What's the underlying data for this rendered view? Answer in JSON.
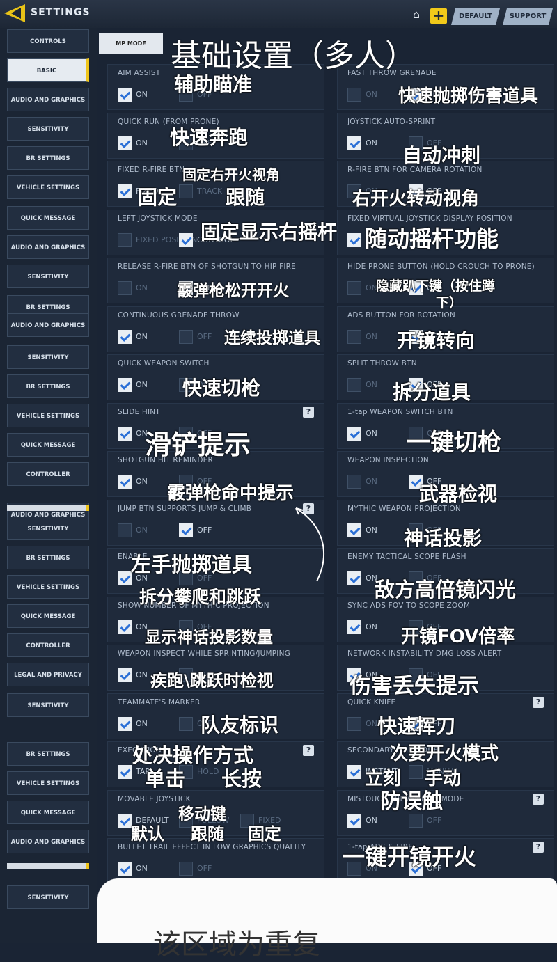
{
  "header": {
    "title": "SETTINGS",
    "default_label": "DEFAULT",
    "support_label": "SUPPORT",
    "icons": [
      "back-arrow-icon",
      "home-icon",
      "plus-icon"
    ]
  },
  "sidebar": {
    "items": [
      {
        "label": "CONTROLS"
      },
      {
        "label": "BASIC",
        "active": true
      },
      {
        "label": "AUDIO AND GRAPHICS"
      },
      {
        "label": "SENSITIVITY"
      },
      {
        "label": "BR SETTINGS"
      },
      {
        "label": "VEHICLE SETTINGS"
      },
      {
        "label": "QUICK MESSAGE"
      },
      {
        "label": "AUDIO AND GRAPHICS"
      },
      {
        "label": "SENSITIVITY"
      },
      {
        "label": "BR SETTINGS"
      },
      {
        "label": "AUDIO AND GRAPHICS"
      },
      {
        "label": "SENSITIVITY"
      },
      {
        "label": "BR SETTINGS"
      },
      {
        "label": "VEHICLE SETTINGS"
      },
      {
        "label": "QUICK MESSAGE"
      },
      {
        "label": "CONTROLLER"
      },
      {
        "label": "AUDIO AND GRAPHICS"
      },
      {
        "label": "SENSITIVITY"
      },
      {
        "label": "BR SETTINGS"
      },
      {
        "label": "VEHICLE SETTINGS"
      },
      {
        "label": "QUICK MESSAGE"
      },
      {
        "label": "CONTROLLER"
      },
      {
        "label": "LEGAL AND PRIVACY"
      },
      {
        "label": "SENSITIVITY"
      },
      {
        "label": "BR SETTINGS"
      },
      {
        "label": "VEHICLE SETTINGS"
      },
      {
        "label": "QUICK MESSAGE"
      },
      {
        "label": "AUDIO AND GRAPHICS"
      },
      {
        "label": "SENSITIVITY"
      }
    ]
  },
  "main": {
    "mode_tab": "MP MODE",
    "page_title": "基础设置（多人）",
    "left": [
      {
        "title": "AIM ASSIST",
        "options": [
          {
            "label": "ON",
            "checked": true
          },
          {
            "label": "OFF",
            "checked": false
          }
        ]
      },
      {
        "title": "QUICK RUN (FROM PRONE)",
        "options": [
          {
            "label": "ON",
            "checked": true
          },
          {
            "label": "OFF",
            "checked": false
          }
        ]
      },
      {
        "title": "FIXED R-FIRE BTN",
        "options": [
          {
            "label": "FIXED",
            "checked": true
          },
          {
            "label": "TRACK",
            "checked": false
          }
        ]
      },
      {
        "title": "LEFT JOYSTICK MODE",
        "options": [
          {
            "label": "FIXED POSITION",
            "checked": false
          },
          {
            "label": "CONTROL",
            "checked": true
          }
        ]
      },
      {
        "title": "RELEASE R-FIRE BTN OF SHOTGUN TO HIP FIRE",
        "options": [
          {
            "label": "ON",
            "checked": false
          },
          {
            "label": "OFF",
            "checked": true
          }
        ]
      },
      {
        "title": "CONTINUOUS GRENADE THROW",
        "options": [
          {
            "label": "ON",
            "checked": true
          },
          {
            "label": "OFF",
            "checked": false
          }
        ]
      },
      {
        "title": "QUICK WEAPON SWITCH",
        "options": [
          {
            "label": "ON",
            "checked": true
          },
          {
            "label": "OFF",
            "checked": false
          }
        ]
      },
      {
        "title": "SLIDE HINT",
        "help": true,
        "options": [
          {
            "label": "ON",
            "checked": true
          },
          {
            "label": "OFF",
            "checked": false
          }
        ]
      },
      {
        "title": "SHOTGUN HIT REMINDER",
        "options": [
          {
            "label": "ON",
            "checked": true
          },
          {
            "label": "OFF",
            "checked": false
          }
        ]
      },
      {
        "title": "JUMP BTN SUPPORTS JUMP & CLIMB",
        "help": true,
        "options": [
          {
            "label": "ON",
            "checked": false
          },
          {
            "label": "OFF",
            "checked": true
          }
        ]
      },
      {
        "title": "ENABLE",
        "options": [
          {
            "label": "ON",
            "checked": true
          },
          {
            "label": "OFF",
            "checked": false
          }
        ]
      },
      {
        "title": "SHOW NUMBER OF MYTHIC PROJECTION",
        "options": [
          {
            "label": "ON",
            "checked": true
          },
          {
            "label": "OFF",
            "checked": false
          }
        ]
      },
      {
        "title": "WEAPON INSPECT WHILE SPRINTING/JUMPING",
        "options": [
          {
            "label": "ON",
            "checked": true
          },
          {
            "label": "OFF",
            "checked": false
          }
        ]
      },
      {
        "title": "TEAMMATE'S MARKER",
        "options": [
          {
            "label": "ON",
            "checked": true
          },
          {
            "label": "OFF",
            "checked": false
          }
        ]
      },
      {
        "title": "EXECUTION",
        "help": true,
        "options": [
          {
            "label": "TAP",
            "checked": true
          },
          {
            "label": "HOLD",
            "checked": false
          }
        ]
      },
      {
        "title": "MOVABLE JOYSTICK",
        "options": [
          {
            "label": "DEFAULT",
            "checked": true
          },
          {
            "label": "FOLLOW",
            "checked": false
          },
          {
            "label": "FIXED",
            "checked": false
          }
        ]
      },
      {
        "title": "BULLET TRAIL EFFECT IN LOW GRAPHICS QUALITY",
        "options": [
          {
            "label": "ON",
            "checked": true
          },
          {
            "label": "OFF",
            "checked": false
          }
        ]
      }
    ],
    "right": [
      {
        "title": "FAST THROW GRENADE",
        "options": [
          {
            "label": "ON",
            "checked": false
          },
          {
            "label": "OFF",
            "checked": true
          }
        ]
      },
      {
        "title": "JOYSTICK AUTO-SPRINT",
        "options": [
          {
            "label": "ON",
            "checked": true
          },
          {
            "label": "OFF",
            "checked": false
          }
        ]
      },
      {
        "title": "R-FIRE BTN FOR CAMERA ROTATION",
        "options": [
          {
            "label": "ON",
            "checked": false
          },
          {
            "label": "OFF",
            "checked": true
          }
        ]
      },
      {
        "title": "FIXED VIRTUAL JOYSTICK DISPLAY POSITION",
        "options": [
          {
            "label": "ON",
            "checked": true
          },
          {
            "label": "OFF",
            "checked": false
          }
        ]
      },
      {
        "title": "HIDE PRONE BUTTON (HOLD CROUCH TO PRONE)",
        "options": [
          {
            "label": "ON",
            "checked": false
          },
          {
            "label": "OFF",
            "checked": true
          }
        ]
      },
      {
        "title": "ADS BUTTON FOR ROTATION",
        "options": [
          {
            "label": "ON",
            "checked": false
          },
          {
            "label": "OFF",
            "checked": true
          }
        ]
      },
      {
        "title": "SPLIT THROW BTN",
        "options": [
          {
            "label": "ON",
            "checked": false
          },
          {
            "label": "OFF",
            "checked": true
          }
        ]
      },
      {
        "title": "1-tap WEAPON SWITCH BTN",
        "options": [
          {
            "label": "ON",
            "checked": true
          },
          {
            "label": "OFF",
            "checked": false
          }
        ]
      },
      {
        "title": "WEAPON INSPECTION",
        "options": [
          {
            "label": "ON",
            "checked": false
          },
          {
            "label": "OFF",
            "checked": true
          }
        ]
      },
      {
        "title": "MYTHIC WEAPON PROJECTION",
        "options": [
          {
            "label": "ON",
            "checked": true
          },
          {
            "label": "OFF",
            "checked": false
          }
        ]
      },
      {
        "title": "ENEMY TACTICAL SCOPE FLASH",
        "options": [
          {
            "label": "ON",
            "checked": true
          },
          {
            "label": "OFF",
            "checked": false
          }
        ]
      },
      {
        "title": "SYNC ADS FOV TO SCOPE ZOOM",
        "options": [
          {
            "label": "ON",
            "checked": true
          },
          {
            "label": "OFF",
            "checked": false
          }
        ]
      },
      {
        "title": "NETWORK INSTABILITY DMG LOSS ALERT",
        "options": [
          {
            "label": "ON",
            "checked": true
          },
          {
            "label": "OFF",
            "checked": false
          }
        ]
      },
      {
        "title": "QUICK KNIFE",
        "help": true,
        "options": [
          {
            "label": "ON",
            "checked": false
          },
          {
            "label": "OFF",
            "checked": true
          }
        ]
      },
      {
        "title": "SECONDARY FIRE MODE",
        "options": [
          {
            "label": "INSTANT",
            "checked": true
          },
          {
            "label": "MANUAL",
            "checked": false
          }
        ]
      },
      {
        "title": "MISTOUCH PREVENTION MODE",
        "help": true,
        "options": [
          {
            "label": "ON",
            "checked": true
          },
          {
            "label": "OFF",
            "checked": false
          }
        ]
      },
      {
        "title": "1-tap ADS & FIRE",
        "help": true,
        "options": [
          {
            "label": "ON",
            "checked": false
          },
          {
            "label": "OFF",
            "checked": true
          }
        ]
      }
    ]
  },
  "annotations": [
    "辅助瞄准",
    "快速抛掷伤害道具",
    "快速奔跑",
    "自动冲刺",
    "固定右开火视角",
    "固定",
    "跟随",
    "右开火转动视角",
    "固定显示右摇杆",
    "随动摇杆功能",
    "霰弹枪松开开火",
    "隐藏趴下键（按住蹲",
    "下）",
    "连续投掷道具",
    "开镜转向",
    "快速切枪",
    "拆分道具",
    "滑铲提示",
    "一键切枪",
    "霰弹枪命中提示",
    "武器检视",
    "神话投影",
    "左手抛掷道具",
    "拆分攀爬和跳跃",
    "敌方高倍镜闪光",
    "显示神话投影数量",
    "开镜FOV倍率",
    "疾跑\\跳跃时检视",
    "伤害丢失提示",
    "队友标识",
    "快速挥刀",
    "处决操作方式",
    "次要开火模式",
    "单击",
    "长按",
    "立刻",
    "手动",
    "防误触",
    "移动键",
    "默认",
    "跟随",
    "固定",
    "一键开镜开火"
  ],
  "footer_text": "该区域为重复"
}
